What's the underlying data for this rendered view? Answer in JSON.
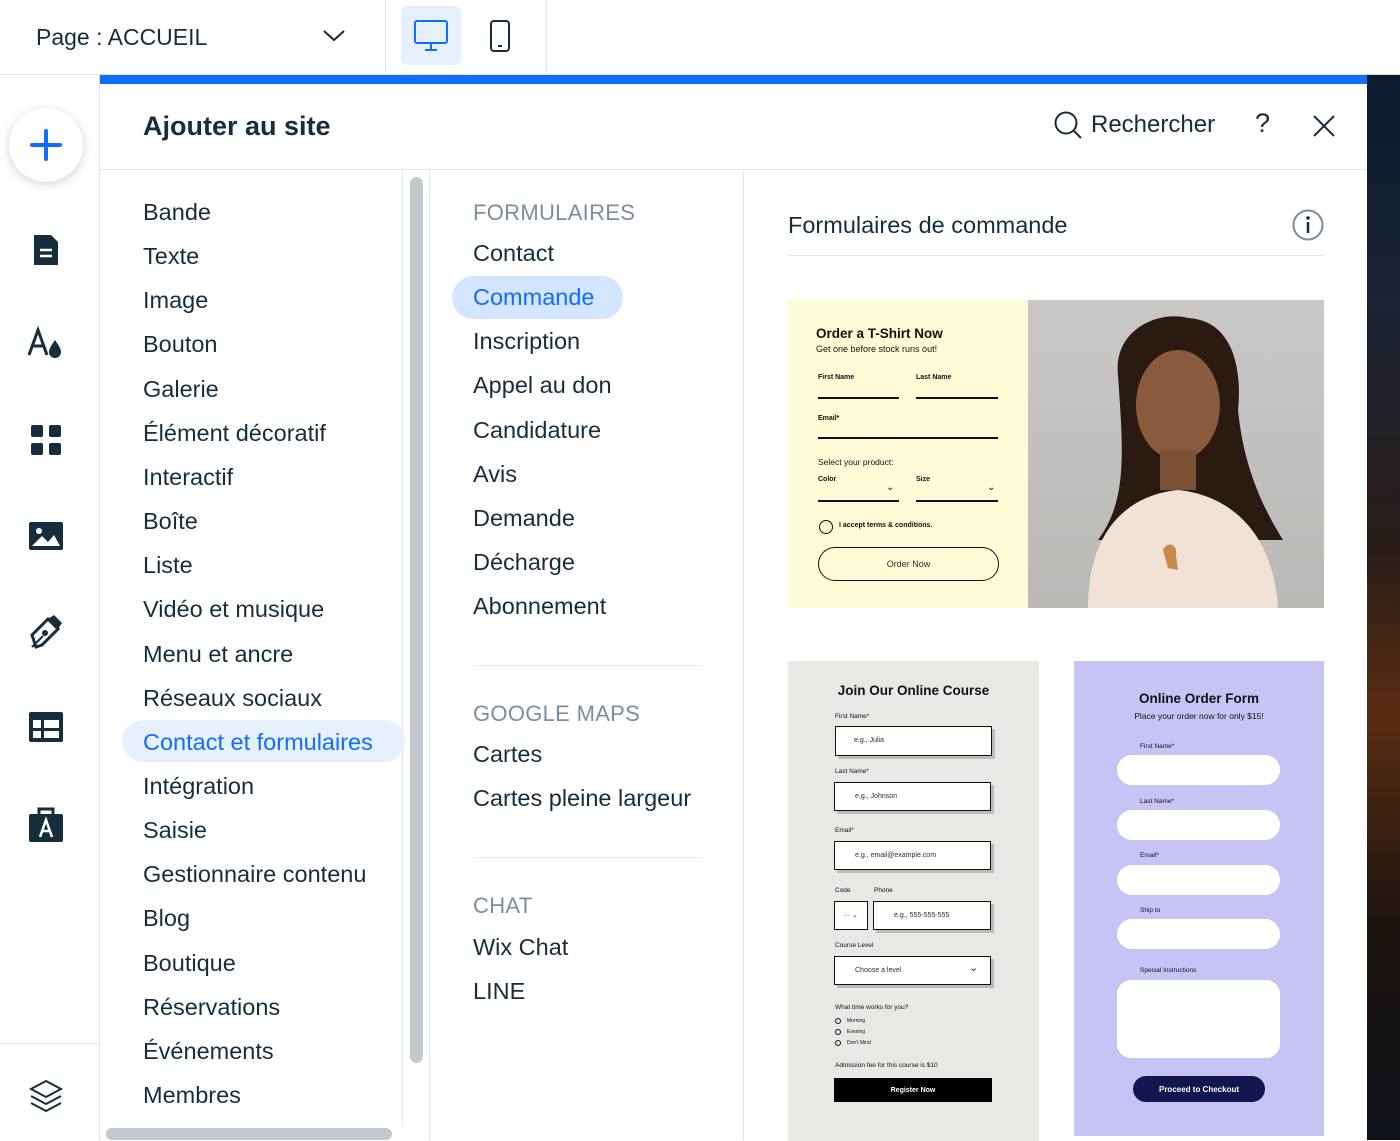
{
  "topbar": {
    "page_label": "Page : ACCUEIL",
    "devices": [
      "desktop-icon",
      "mobile-icon"
    ]
  },
  "leftbar": {
    "icons": [
      "plus-icon",
      "pages-icon",
      "theme-icon",
      "apps-icon",
      "media-icon",
      "pen-icon",
      "table-icon",
      "portfolio-icon",
      "layers-icon"
    ]
  },
  "panel": {
    "title": "Ajouter au site",
    "search_label": "Rechercher",
    "help": "?",
    "accent": "#116dff"
  },
  "categories": [
    "Bande",
    "Texte",
    "Image",
    "Bouton",
    "Galerie",
    "Élément décoratif",
    "Interactif",
    "Boîte",
    "Liste",
    "Vidéo et musique",
    "Menu et ancre",
    "Réseaux sociaux",
    "Contact et formulaires",
    "Intégration",
    "Saisie",
    "Gestionnaire contenu",
    "Blog",
    "Boutique",
    "Réservations",
    "Événements",
    "Membres"
  ],
  "selected_category": "Contact et formulaires",
  "subcategories": {
    "forms_header": "FORMULAIRES",
    "forms": [
      "Contact",
      "Commande",
      "Inscription",
      "Appel au don",
      "Candidature",
      "Avis",
      "Demande",
      "Décharge",
      "Abonnement"
    ],
    "maps_header": "GOOGLE MAPS",
    "maps": [
      "Cartes",
      "Cartes pleine largeur"
    ],
    "chat_header": "CHAT",
    "chat": [
      "Wix Chat",
      "LINE"
    ]
  },
  "selected_sub": "Commande",
  "gallery": {
    "title": "Formulaires de commande",
    "tshirt": {
      "title": "Order a T-Shirt Now",
      "subtitle": "Get one before stock runs out!",
      "first": "First Name",
      "last": "Last Name",
      "email": "Email*",
      "select": "Select your product:",
      "color": "Color",
      "size": "Size",
      "terms": "I accept terms & conditions.",
      "button": "Order Now"
    },
    "course": {
      "title": "Join Our Online Course",
      "first": "First Name*",
      "first_ph": "e.g., Julia",
      "last": "Last Name*",
      "last_ph": "e.g., Johnson",
      "email": "Email*",
      "email_ph": "e.g., email@example.com",
      "code": "Code",
      "code_val": "···",
      "phone": "Phone",
      "phone_ph": "e.g., 555-555-555",
      "level": "Course Level",
      "level_ph": "Choose a level",
      "time_q": "What time works for you?",
      "times": [
        "Morning",
        "Evening",
        "Don't Mind"
      ],
      "fee": "Admission fee for this course is $10",
      "button": "Register Now"
    },
    "order": {
      "title": "Online Order Form",
      "subtitle": "Place your order now for only $15!",
      "first": "First Name*",
      "last": "Last Name*",
      "email": "Email*",
      "ship": "Ship to",
      "special": "Special Instructions",
      "button": "Proceed to Checkout"
    }
  }
}
